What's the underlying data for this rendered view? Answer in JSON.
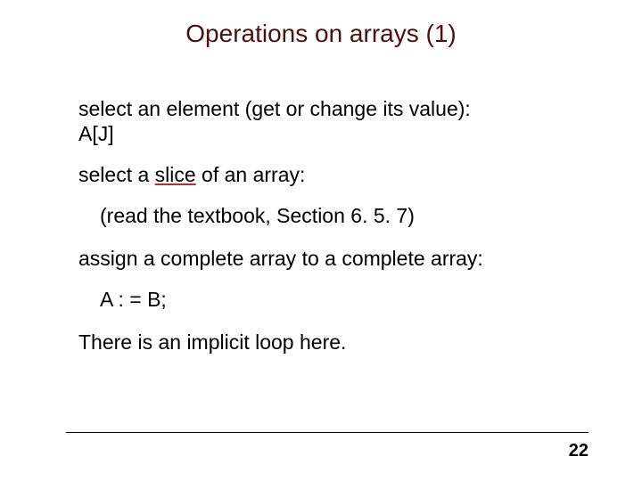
{
  "title": "Operations on arrays (1)",
  "lines": {
    "select_element": "select an element (get or change its value):",
    "select_element_code": "A[J]",
    "select_slice_pre": "select a ",
    "select_slice_word": "slice",
    "select_slice_post": " of an array:",
    "read_textbook": "(read the textbook, Section 6. 5. 7)",
    "assign_array": "assign a complete array to a complete array:",
    "assign_code": "A : = B;",
    "implicit_loop": "There is an implicit loop here."
  },
  "page_number": "22"
}
